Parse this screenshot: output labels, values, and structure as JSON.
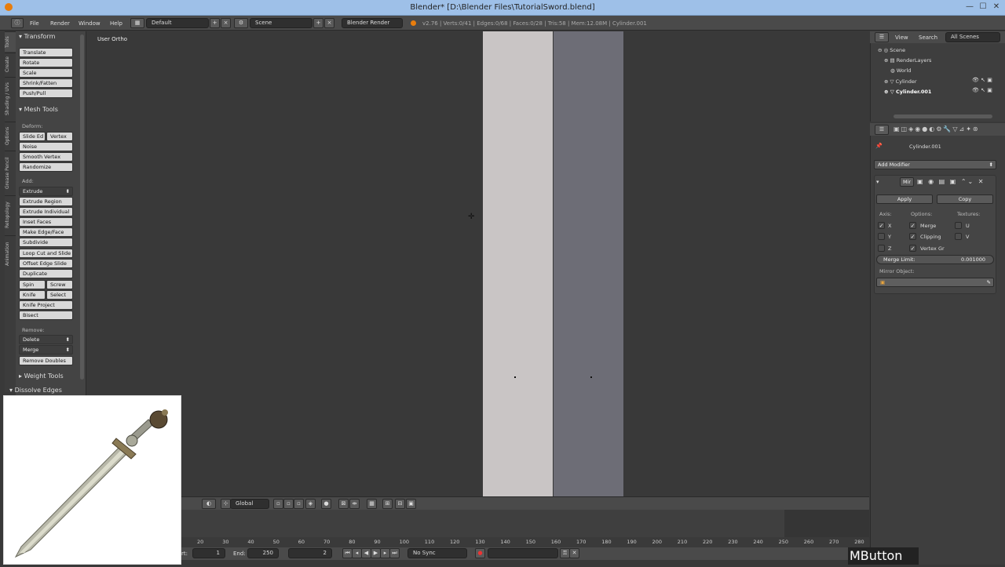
{
  "window": {
    "title": "Blender* [D:\\Blender Files\\TutorialSword.blend]"
  },
  "menu": {
    "items": [
      "File",
      "Render",
      "Window",
      "Help"
    ]
  },
  "layout_field": "Default",
  "scene_field": "Scene",
  "render_engine": "Blender Render",
  "stats": "v2.76 | Verts:0/41 | Edges:0/68 | Faces:0/28 | Tris:58 | Mem:12.08M | Cylinder.001",
  "tabs": [
    "Tools",
    "Create",
    "Shading / UVs",
    "Options",
    "Grease Pencil",
    "Retopology",
    "Animation"
  ],
  "transform": {
    "header": "Transform",
    "buttons": [
      "Translate",
      "Rotate",
      "Scale",
      "Shrink/Fatten",
      "Push/Pull"
    ]
  },
  "mesh_tools": {
    "header": "Mesh Tools",
    "deform_label": "Deform:",
    "slide_edge": "Slide Ed",
    "vertex": "Vertex",
    "noise": "Noise",
    "smooth_vertex": "Smooth Vertex",
    "randomize": "Randomize",
    "add_label": "Add:",
    "extrude": "Extrude",
    "extrude_region": "Extrude Region",
    "extrude_individual": "Extrude Individual",
    "inset_faces": "Inset Faces",
    "make_edge_face": "Make Edge/Face",
    "subdivide": "Subdivide",
    "loop_cut": "Loop Cut and Slide",
    "offset_edge": "Offset Edge Slide",
    "duplicate": "Duplicate",
    "spin": "Spin",
    "screw": "Screw",
    "knife": "Knife",
    "select": "Select",
    "knife_project": "Knife Project",
    "bisect": "Bisect",
    "remove_label": "Remove:",
    "delete": "Delete",
    "merge": "Merge",
    "remove_doubles": "Remove Doubles"
  },
  "weight_tools": "Weight Tools",
  "dissolve_edges": "Dissolve Edges",
  "viewport": {
    "view_label": "User Ortho",
    "orientation": "Global"
  },
  "timeline": {
    "ticks": [
      "20",
      "30",
      "40",
      "50",
      "60",
      "70",
      "80",
      "90",
      "100",
      "110",
      "120",
      "130",
      "140",
      "150",
      "160",
      "170",
      "180",
      "190",
      "200",
      "210",
      "220",
      "230",
      "240",
      "250",
      "260",
      "270",
      "280"
    ],
    "start_label": "rt:",
    "start_value": "1",
    "end_label": "End:",
    "end_value": "250",
    "current_frame": "2",
    "sync": "No Sync"
  },
  "outliner": {
    "tabs": [
      "View",
      "Search",
      "All Scenes"
    ],
    "rows": [
      "Scene",
      "RenderLayers",
      "World",
      "Cylinder",
      "Cylinder.001"
    ]
  },
  "properties": {
    "object_name": "Cylinder.001",
    "add_modifier": "Add Modifier",
    "modifier_name": "Mir",
    "apply": "Apply",
    "copy": "Copy",
    "axis_label": "Axis:",
    "options_label": "Options:",
    "textures_label": "Textures:",
    "axis_x": "X",
    "axis_y": "Y",
    "axis_z": "Z",
    "opt_merge": "Merge",
    "opt_clipping": "Clipping",
    "opt_vertex": "Vertex Gr",
    "tex_u": "U",
    "tex_v": "V",
    "merge_limit_label": "Merge Limit:",
    "merge_limit_value": "0.001000",
    "mirror_object_label": "Mirror Object:"
  },
  "overlay": {
    "mbutton": "MButton"
  },
  "colors": {
    "titlebar": "#9ec0e8",
    "bar_light": "#c9c5c5",
    "bar_dark": "#6d6d76"
  }
}
